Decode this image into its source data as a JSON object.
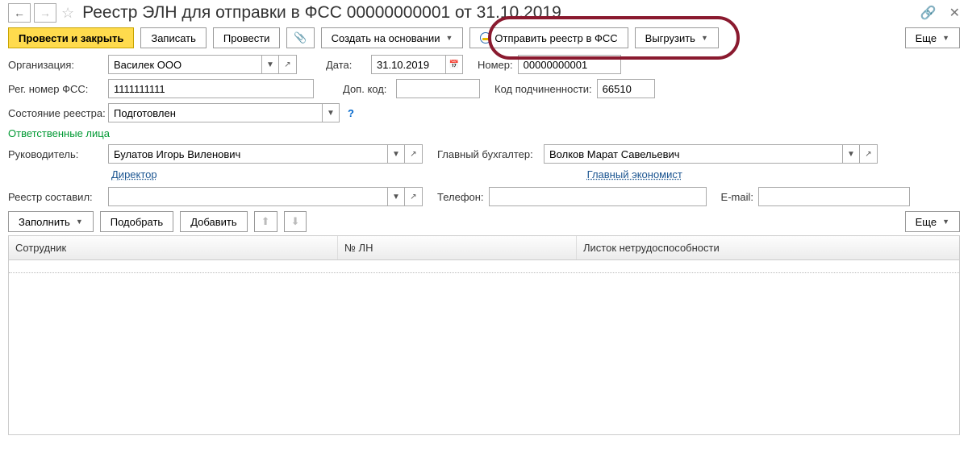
{
  "header": {
    "title": "Реестр ЭЛН для отправки в ФСС 00000000001 от 31.10.2019"
  },
  "toolbar": {
    "post_close": "Провести и закрыть",
    "write": "Записать",
    "post": "Провести",
    "create_based": "Создать на основании",
    "send_fss": "Отправить реестр в ФСС",
    "export": "Выгрузить",
    "more": "Еще"
  },
  "fields": {
    "org_label": "Организация:",
    "org_value": "Василек ООО",
    "date_label": "Дата:",
    "date_value": "31.10.2019",
    "number_label": "Номер:",
    "number_value": "00000000001",
    "reg_label": "Рег. номер ФСС:",
    "reg_value": "1111111111",
    "addcode_label": "Доп. код:",
    "addcode_value": "",
    "subord_label": "Код подчиненности:",
    "subord_value": "66510",
    "state_label": "Состояние реестра:",
    "state_value": "Подготовлен"
  },
  "responsible": {
    "section": "Ответственные лица",
    "head_label": "Руководитель:",
    "head_value": "Булатов Игорь Виленович",
    "head_role": "Директор",
    "acc_label": "Главный бухгалтер:",
    "acc_value": "Волков Марат Савельевич",
    "acc_role": "Главный экономист",
    "compiled_label": "Реестр составил:",
    "compiled_value": "",
    "phone_label": "Телефон:",
    "phone_value": "",
    "email_label": "E-mail:",
    "email_value": ""
  },
  "table_toolbar": {
    "fill": "Заполнить",
    "pick": "Подобрать",
    "add": "Добавить",
    "more": "Еще"
  },
  "table": {
    "col1": "Сотрудник",
    "col2": "№ ЛН",
    "col3": "Листок нетрудоспособности"
  }
}
